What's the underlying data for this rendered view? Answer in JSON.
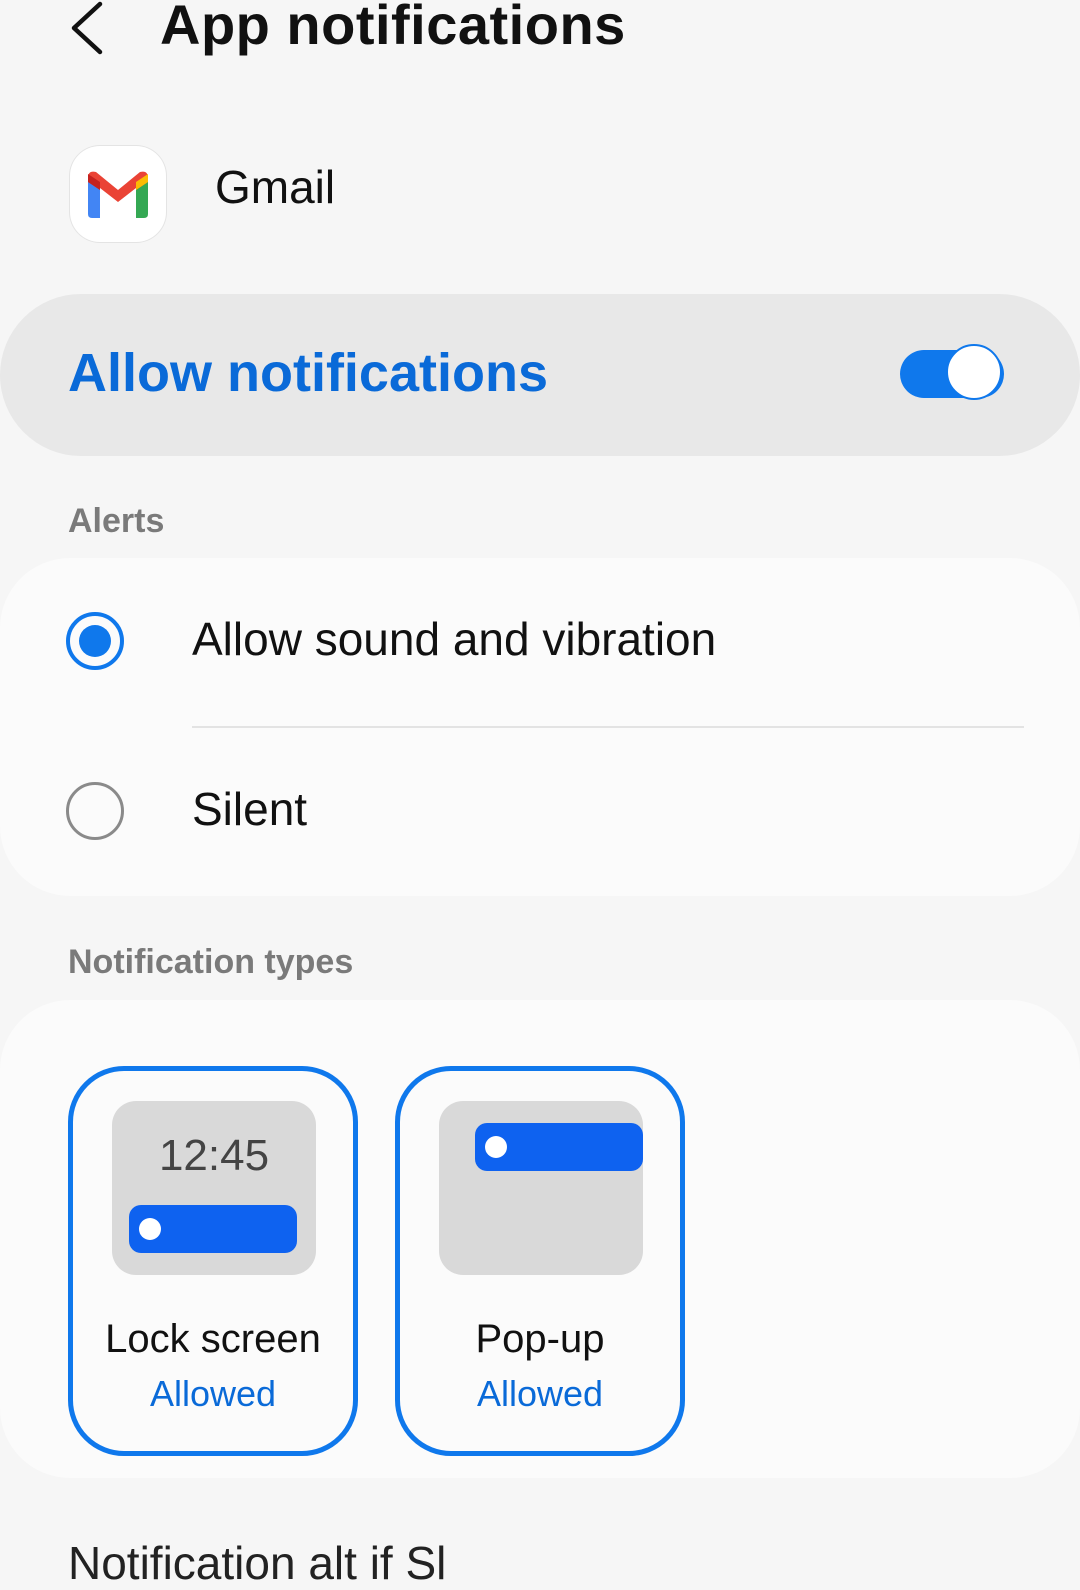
{
  "header": {
    "title": "App notifications",
    "back_icon": "chevron-left-icon"
  },
  "app": {
    "name": "Gmail",
    "icon": "gmail-logo-icon"
  },
  "allow_notifications": {
    "label": "Allow notifications",
    "enabled": true
  },
  "alerts": {
    "section_title": "Alerts",
    "options": [
      {
        "label": "Allow sound and vibration",
        "selected": true
      },
      {
        "label": "Silent",
        "selected": false
      }
    ]
  },
  "notification_types": {
    "section_title": "Notification types",
    "items": [
      {
        "name": "Lock screen",
        "status": "Allowed",
        "preview_time": "12:45"
      },
      {
        "name": "Pop-up",
        "status": "Allowed"
      }
    ]
  },
  "footer": {
    "partial_text": "Notification    alt                    if Sl"
  },
  "colors": {
    "accent": "#0f78ec",
    "accent_text": "#0a6ad8",
    "notif_bar": "#0e62f0",
    "background": "#f6f6f6"
  }
}
